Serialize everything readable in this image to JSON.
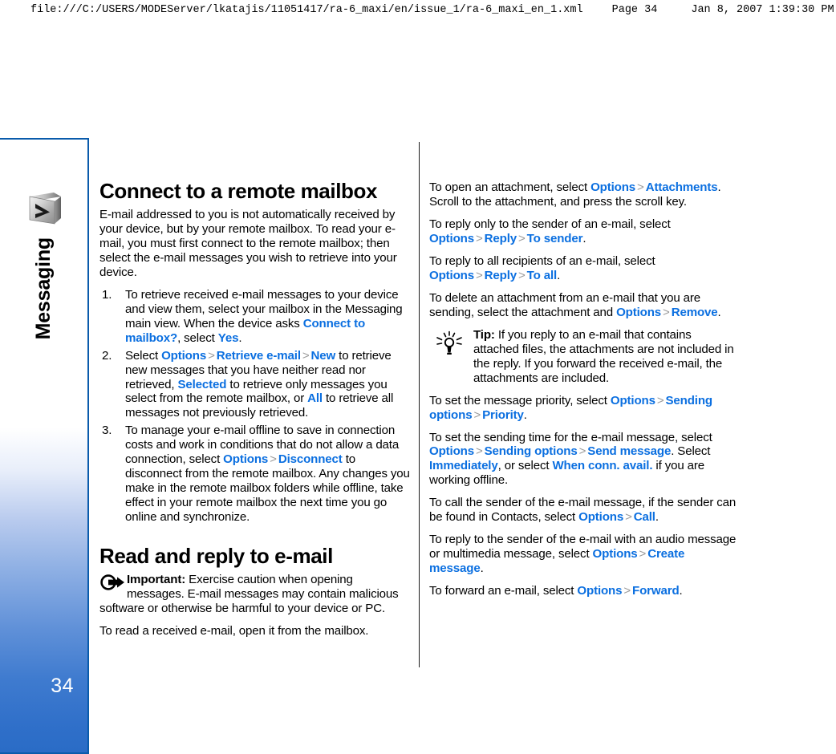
{
  "print_header": {
    "url": "file:///C:/USERS/MODEServer/lkatajis/11051417/ra-6_maxi/en/issue_1/ra-6_maxi_en_1.xml",
    "page_label": "Page 34",
    "timestamp": "Jan 8, 2007 1:39:30 PM"
  },
  "sidebar": {
    "chapter_label": "Messaging",
    "icon": "envelope-message-icon",
    "page_number": "34",
    "accent_color": "#0a5bab",
    "gradient_bottom_color": "#2a6cc6"
  },
  "colors": {
    "ui_term_blue": "#0b6fe0",
    "separator_gray": "#9a9a9a",
    "text_black": "#000000"
  },
  "left_column": {
    "title": "Connect to a remote mailbox",
    "intro": "E-mail addressed to you is not automatically received by your device, but by your remote mailbox. To read your e-mail, you must first connect to the remote mailbox; then select the e-mail messages you wish to retrieve into your device.",
    "steps": [
      {
        "t1": "To retrieve received e-mail messages to your device and view them, select your mailbox in the Messaging main view. When the device asks ",
        "ui1": "Connect to mailbox?",
        "t2": ", select ",
        "ui2": "Yes",
        "t3": "."
      },
      {
        "t1": "Select ",
        "ui1": "Options",
        "ui2": "Retrieve e-mail",
        "ui3": "New",
        "t2": " to retrieve new messages that you have neither read nor retrieved, ",
        "ui4": "Selected",
        "t3": " to retrieve only messages you select from the remote mailbox, or ",
        "ui5": "All",
        "t4": " to retrieve all messages not previously retrieved."
      },
      {
        "t1": "To manage your e-mail offline to save in connection costs and work in conditions that do not allow a data connection, select ",
        "ui1": "Options",
        "ui2": "Disconnect",
        "t2": " to disconnect from the remote mailbox. Any changes you make in the remote mailbox folders while offline, take effect in your remote mailbox the next time you go online and synchronize."
      }
    ],
    "section2_title": "Read and reply to e-mail",
    "important_note": {
      "icon": "important-arrow-icon",
      "label": "Important:",
      "text": "  Exercise caution when opening messages. E-mail messages may contain malicious software or otherwise be harmful to your device or PC."
    },
    "closing_text": "To read a received e-mail, open it from the mailbox."
  },
  "right_column": {
    "paragraphs": [
      {
        "t1": "To open an attachment, select ",
        "ui1": "Options",
        "ui2": "Attachments",
        "t2": ". Scroll to the attachment, and press the scroll key."
      },
      {
        "t1": "To reply only to the sender of an e-mail, select ",
        "ui1": "Options",
        "ui2": "Reply",
        "ui3": "To sender",
        "t2": "."
      },
      {
        "t1": "To reply to all recipients of an e-mail, select ",
        "ui1": "Options",
        "ui2": "Reply",
        "ui3": "To all",
        "t2": "."
      },
      {
        "t1": "To delete an attachment from an e-mail that you are sending, select the attachment and ",
        "ui1": "Options",
        "ui2": "Remove",
        "t2": "."
      }
    ],
    "tip_note": {
      "icon": "lightbulb-tip-icon",
      "label": "Tip:",
      "text": " If you reply to an e-mail that contains attached files, the attachments are not included in the reply. If you forward the received e-mail, the attachments are included."
    },
    "paragraphs2": [
      {
        "t1": "To set the message priority, select ",
        "ui1": "Options",
        "ui2": "Sending options",
        "ui3": "Priority",
        "t2": "."
      },
      {
        "t1": "To set the sending time for the e-mail message, select ",
        "ui1": "Options",
        "ui2": "Sending options",
        "ui3": "Send message",
        "t2": ". Select ",
        "ui4": "Immediately",
        "t3": ", or select ",
        "ui5": "When conn. avail.",
        "t4": " if you are working offline."
      },
      {
        "t1": "To call the sender of the e-mail message, if the sender can be found in Contacts, select ",
        "ui1": "Options",
        "ui2": "Call",
        "t2": "."
      },
      {
        "t1": "To reply to the sender of the e-mail with an audio message or multimedia message, select ",
        "ui1": "Options",
        "ui2": "Create message",
        "t2": "."
      },
      {
        "t1": "To forward an e-mail, select ",
        "ui1": "Options",
        "ui2": "Forward",
        "t2": "."
      }
    ]
  }
}
